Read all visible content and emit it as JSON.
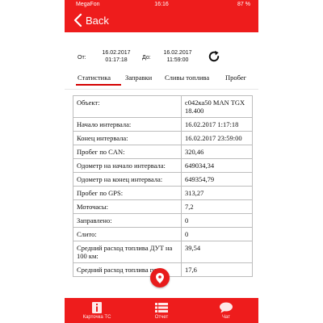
{
  "status_bar": {
    "carrier": "MegaFon",
    "time": "16:16",
    "battery": "87 %"
  },
  "header": {
    "back_label": "Back"
  },
  "period": {
    "from_label": "От:",
    "from_date": "16.02.2017",
    "from_time": "01:17:18",
    "to_label": "До:",
    "to_date": "16.02.2017",
    "to_time": "11:59:00"
  },
  "tabs": [
    {
      "label": "Статистика",
      "active": true
    },
    {
      "label": "Заправки",
      "active": false
    },
    {
      "label": "Сливы топлива",
      "active": false
    },
    {
      "label": "Пробег",
      "active": false
    }
  ],
  "table": {
    "rows": [
      {
        "label": "Объект:",
        "value": "с042ка50 MAN TGX 18.400"
      },
      {
        "label": "Начало интервала:",
        "value": "16.02.2017 1:17:18"
      },
      {
        "label": "Конец интервала:",
        "value": "16.02.2017 23:59:00"
      },
      {
        "label": "Пробег по CAN:",
        "value": "320,46"
      },
      {
        "label": "Одометр на начало интервала:",
        "value": "649034,34"
      },
      {
        "label": "Одометр на конец интервала:",
        "value": "649354,79"
      },
      {
        "label": "Пробег по GPS:",
        "value": "313,27"
      },
      {
        "label": "Моточасы:",
        "value": "7,2"
      },
      {
        "label": "Заправлено:",
        "value": "0"
      },
      {
        "label": "Слито:",
        "value": "0"
      },
      {
        "label": "Средний расход топлива ДУТ на 100 км:",
        "value": "39,54"
      },
      {
        "label": "Средний расход топлива по",
        "value": "17,6"
      }
    ]
  },
  "tabbar": [
    {
      "label": "Карточка ТС",
      "icon": "info-icon"
    },
    {
      "label": "Отчет",
      "icon": "list-icon"
    },
    {
      "label": "Чат",
      "icon": "chat-icon"
    }
  ],
  "colors": {
    "accent": "#ee1c1c",
    "tab_underline": "#d40000"
  }
}
